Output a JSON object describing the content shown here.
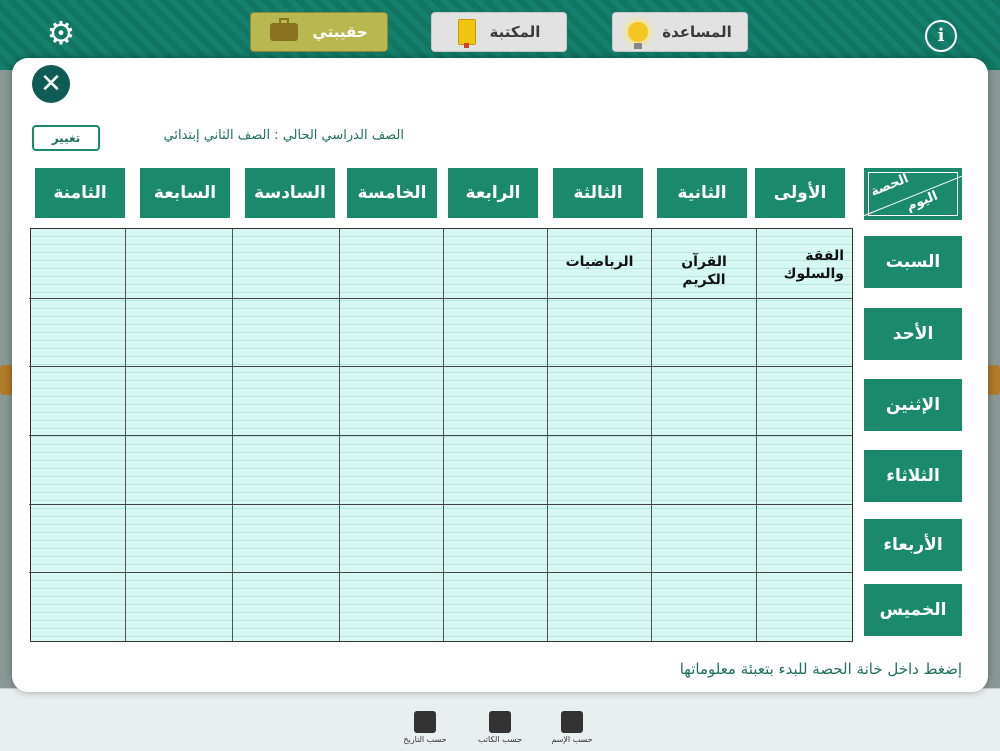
{
  "top_nav": {
    "bag_label": "حقيبتي",
    "library_label": "المكتبة",
    "help_label": "المساعدة",
    "settings_icon": "gear-icon",
    "info_icon": "info-icon"
  },
  "bottom_nav": {
    "by_date": "حسب التاريخ",
    "by_author": "حسب الكاتب",
    "by_name": "حسب الإسم"
  },
  "modal": {
    "grade_text": "الصف الدراسي الحالي : الصف الثاني إبتدائي",
    "change_label": "تغيير",
    "corner_period": "الحصة",
    "corner_day": "اليوم",
    "periods": [
      "الأولى",
      "الثانية",
      "الثالثة",
      "الرابعة",
      "الخامسة",
      "السادسة",
      "السابعة",
      "الثامنة"
    ],
    "days": [
      "السبت",
      "الأحد",
      "الإثنين",
      "الثلاثاء",
      "الأربعاء",
      "الخميس"
    ],
    "schedule": [
      [
        "الفقة والسلوك",
        "القرآن الكريم",
        "الرياضيات",
        "",
        "",
        "",
        "",
        ""
      ],
      [
        "",
        "",
        "",
        "",
        "",
        "",
        "",
        ""
      ],
      [
        "",
        "",
        "",
        "",
        "",
        "",
        "",
        ""
      ],
      [
        "",
        "",
        "",
        "",
        "",
        "",
        "",
        ""
      ],
      [
        "",
        "",
        "",
        "",
        "",
        "",
        "",
        ""
      ],
      [
        "",
        "",
        "",
        "",
        "",
        "",
        "",
        ""
      ]
    ],
    "hint": "إضغط داخل خانة الحصة للبدء بتعبئة معلوماتها"
  },
  "colors": {
    "primary": "#1b8a6c",
    "header_bg": "#117562",
    "table_bg": "#d6f7f2",
    "active_tab": "#b9b850"
  }
}
